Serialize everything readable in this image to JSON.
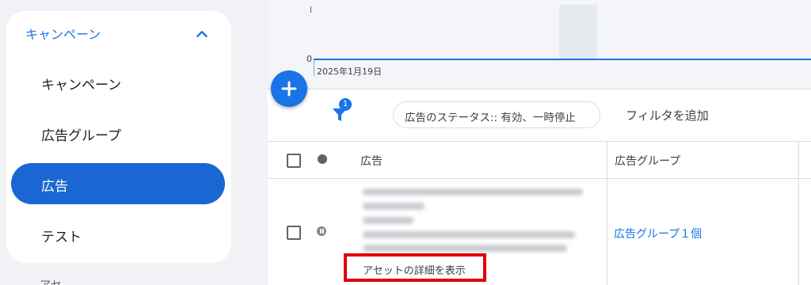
{
  "sidebar": {
    "section_label": "キャンペーン",
    "items": [
      {
        "label": "キャンペーン",
        "active": false
      },
      {
        "label": "広告グループ",
        "active": false
      },
      {
        "label": "広告",
        "active": true
      },
      {
        "label": "テスト",
        "active": false
      }
    ],
    "cutoff_label": "アセット"
  },
  "chart": {
    "zero_label": "0",
    "date_label": "2025年1月19日",
    "line_color": "#1a73e8"
  },
  "toolbar": {
    "filter_count": "1",
    "status_filter": "広告のステータス:: 有効、一時停止",
    "add_filter": "フィルタを追加"
  },
  "table": {
    "columns": [
      "広告",
      "広告グループ"
    ],
    "rows": [
      {
        "status": "paused",
        "asset_link": "アセットの詳細を表示",
        "ad_group": "広告グループ１個"
      }
    ]
  },
  "colors": {
    "accent": "#1a73e8",
    "active_nav": "#1a66d2",
    "highlight_box": "#e0000a"
  }
}
